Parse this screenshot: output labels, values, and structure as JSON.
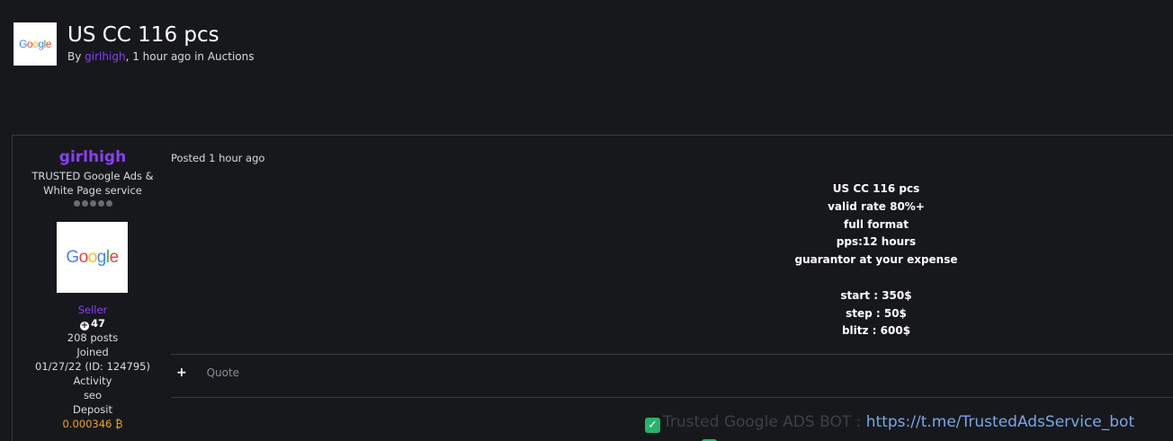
{
  "topic": {
    "title": "US CC 116 pcs",
    "by_label": "By",
    "author": "girlhigh",
    "time_text": ", 1 hour ago in",
    "forum": "Auctions"
  },
  "logo": {
    "letters": [
      "G",
      "o",
      "o",
      "g",
      "l",
      "e"
    ]
  },
  "author_panel": {
    "name": "girlhigh",
    "title": "TRUSTED Google Ads & White Page service",
    "group": "Seller",
    "reputation": "47",
    "posts": "208 posts",
    "joined_label": "Joined",
    "joined_value": "01/27/22 (ID: 124795)",
    "activity_label": "Activity",
    "activity_value": "seo",
    "deposit_label": "Deposit",
    "deposit_value": "0.000346 ₿"
  },
  "post": {
    "posted": "Posted 1 hour ago",
    "lines": [
      "US CC 116 pcs",
      "valid rate 80%+",
      "full format",
      "pps:12 hours",
      "guarantor at your expense",
      "",
      "start : 350$",
      "step : 50$",
      "blitz :  600$"
    ],
    "quote_label": "Quote"
  },
  "signature": {
    "text": "Trusted Google ADS BOT : ",
    "link": "https://t.me/TrustedAdsService_bot"
  },
  "colors": {
    "accent": "#8a3ff7",
    "background": "#17181c",
    "deposit": "#f0a51f",
    "check": "#26b36b"
  }
}
